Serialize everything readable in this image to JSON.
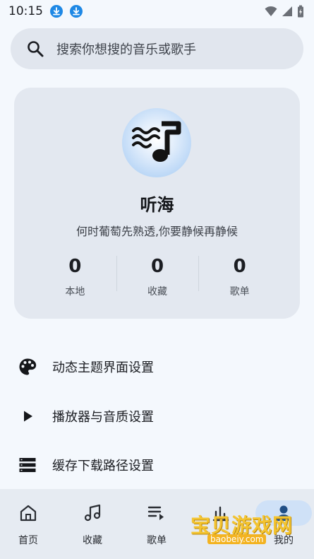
{
  "status_bar": {
    "time": "10:15",
    "icons": [
      "download-icon",
      "download-icon",
      "wifi-icon",
      "signal-icon",
      "battery-icon"
    ]
  },
  "search": {
    "placeholder": "搜索你想搜的音乐或歌手"
  },
  "profile": {
    "name": "听海",
    "motto": "何时葡萄先熟透,你要静候再静候",
    "avatar_icon": "music-note-waves-icon",
    "stats": [
      {
        "value": "0",
        "label": "本地"
      },
      {
        "value": "0",
        "label": "收藏"
      },
      {
        "value": "0",
        "label": "歌单"
      }
    ]
  },
  "settings": [
    {
      "label": "动态主题界面设置",
      "icon": "palette-icon"
    },
    {
      "label": "播放器与音质设置",
      "icon": "play-icon"
    },
    {
      "label": "缓存下载路径设置",
      "icon": "storage-icon"
    }
  ],
  "bottom_nav": {
    "items": [
      {
        "label": "首页",
        "icon": "home-icon"
      },
      {
        "label": "收藏",
        "icon": "music-note-icon"
      },
      {
        "label": "歌单",
        "icon": "playlist-icon"
      },
      {
        "label": "",
        "icon": "chart-icon"
      },
      {
        "label": "我的",
        "icon": "person-icon"
      }
    ],
    "active_index": 4
  },
  "watermark": {
    "text": "宝贝游戏网",
    "url": "baobeiy.com"
  },
  "colors": {
    "background": "#f4f8fd",
    "card": "#e3e8f0",
    "accent": "#1e88e5",
    "nav_active": "#cfe1f7"
  }
}
